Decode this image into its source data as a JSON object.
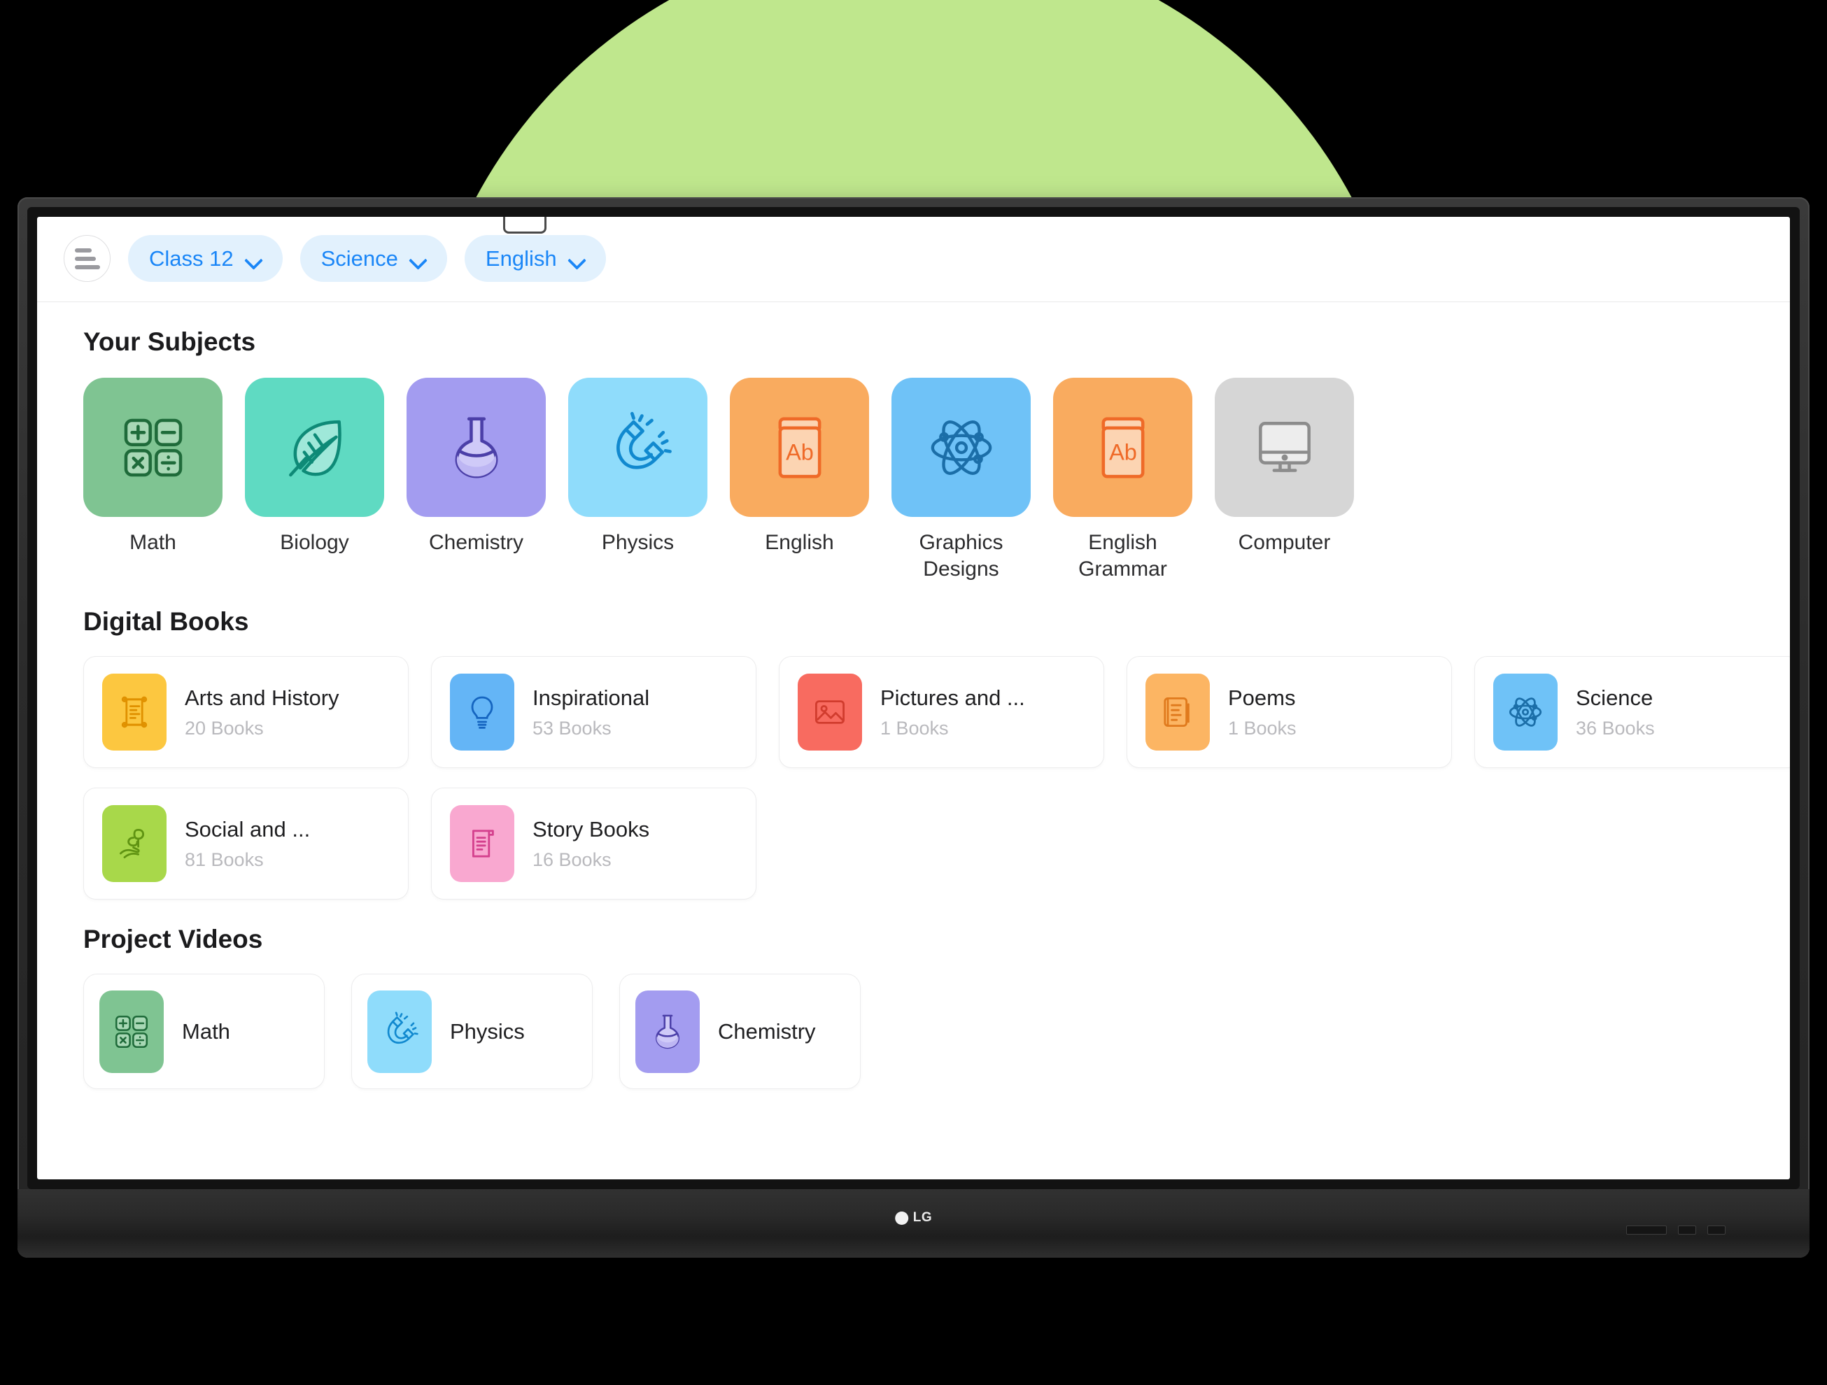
{
  "device": {
    "brand": "LG"
  },
  "header": {
    "menu_icon": "hamburger-menu-icon",
    "filters": [
      {
        "label": "Class 12",
        "icon": "chevron-down-icon"
      },
      {
        "label": "Science",
        "icon": "chevron-down-icon"
      },
      {
        "label": "English",
        "icon": "chevron-down-icon"
      }
    ]
  },
  "sections": {
    "subjects": {
      "title": "Your Subjects",
      "items": [
        {
          "label": "Math",
          "icon": "calculator-icon",
          "tile_color": "#7fc492",
          "icon_color": "#1f6b3a"
        },
        {
          "label": "Biology",
          "icon": "leaf-icon",
          "tile_color": "#5fdac2",
          "icon_color": "#0e8a77"
        },
        {
          "label": "Chemistry",
          "icon": "flask-icon",
          "tile_color": "#a39cf0",
          "icon_color": "#4b3fa8"
        },
        {
          "label": "Physics",
          "icon": "magnet-icon",
          "tile_color": "#8fdcfb",
          "icon_color": "#1189cf"
        },
        {
          "label": "English",
          "icon": "ab-book-icon",
          "tile_color": "#f9ab5f",
          "icon_color": "#ef6a28"
        },
        {
          "label": "Graphics Designs",
          "icon": "atom-icon",
          "tile_color": "#6fc2f7",
          "icon_color": "#1b6ea8"
        },
        {
          "label": "English Grammar",
          "icon": "ab-book-icon",
          "tile_color": "#f9ab5f",
          "icon_color": "#ef6a28"
        },
        {
          "label": "Computer",
          "icon": "monitor-icon",
          "tile_color": "#d6d6d6",
          "icon_color": "#8c8c8c"
        }
      ]
    },
    "digital_books": {
      "title": "Digital Books",
      "rows": [
        [
          {
            "title": "Arts and History",
            "count": "20 Books",
            "icon": "scroll-icon",
            "icon_bg": "#fcc740",
            "icon_color": "#e09100"
          },
          {
            "title": "Inspirational",
            "count": "53 Books",
            "icon": "lightbulb-icon",
            "icon_bg": "#64b5f6",
            "icon_color": "#1565c0"
          },
          {
            "title": "Pictures and ...",
            "count": "1 Books",
            "icon": "image-icon",
            "icon_bg": "#f86b60",
            "icon_color": "#d13c2e"
          },
          {
            "title": "Poems",
            "count": "1 Books",
            "icon": "notebook-icon",
            "icon_bg": "#fcb563",
            "icon_color": "#e07a1d"
          },
          {
            "title": "Science",
            "count": "36 Books",
            "icon": "atom-icon",
            "icon_bg": "#6fc2f7",
            "icon_color": "#1b6ea8"
          }
        ],
        [
          {
            "title": "Social and ...",
            "count": "81 Books",
            "icon": "hand-plant-icon",
            "icon_bg": "#a8d84a",
            "icon_color": "#5f9312"
          },
          {
            "title": "Story Books",
            "count": "16 Books",
            "icon": "document-icon",
            "icon_bg": "#f9a8d0",
            "icon_color": "#d4408d"
          }
        ]
      ]
    },
    "project_videos": {
      "title": "Project Videos",
      "items": [
        {
          "label": "Math",
          "icon": "calculator-icon",
          "icon_bg": "#7fc492",
          "icon_color": "#1f6b3a"
        },
        {
          "label": "Physics",
          "icon": "magnet-icon",
          "icon_bg": "#8fdcfb",
          "icon_color": "#1189cf"
        },
        {
          "label": "Chemistry",
          "icon": "flask-icon",
          "icon_bg": "#a39cf0",
          "icon_color": "#4b3fa8"
        }
      ]
    }
  },
  "colors": {
    "accent_blue": "#1a86f7",
    "pill_bg": "#e2f1fd",
    "backdrop_green": "#a6d95f",
    "backdrop_green_light": "#bfe78d"
  }
}
